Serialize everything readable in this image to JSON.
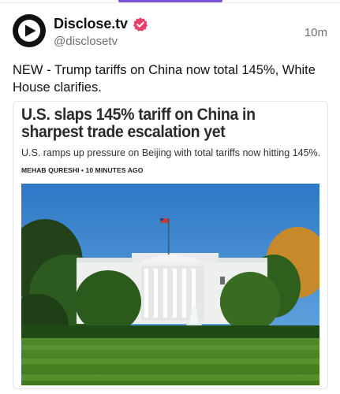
{
  "post": {
    "author_name": "Disclose.tv",
    "author_handle": "@disclosetv",
    "timestamp": "10m",
    "verified": true,
    "text": "NEW - Trump tariffs on China now total 145%, White House clarifies."
  },
  "card": {
    "headline": "U.S. slaps 145% tariff on China in sharpest trade escalation yet",
    "subheadline": "U.S. ramps up pressure on Beijing with total tariffs now hitting 145%.",
    "byline": "MEHAB QURESHI • 10 MINUTES AGO"
  },
  "colors": {
    "accent": "#7b55d6",
    "verified_badge": "#e8416b",
    "text_primary": "#0f1419",
    "text_secondary": "#6b6f76"
  },
  "icons": {
    "avatar": "play-logo-icon",
    "verified": "verified-badge-icon"
  }
}
